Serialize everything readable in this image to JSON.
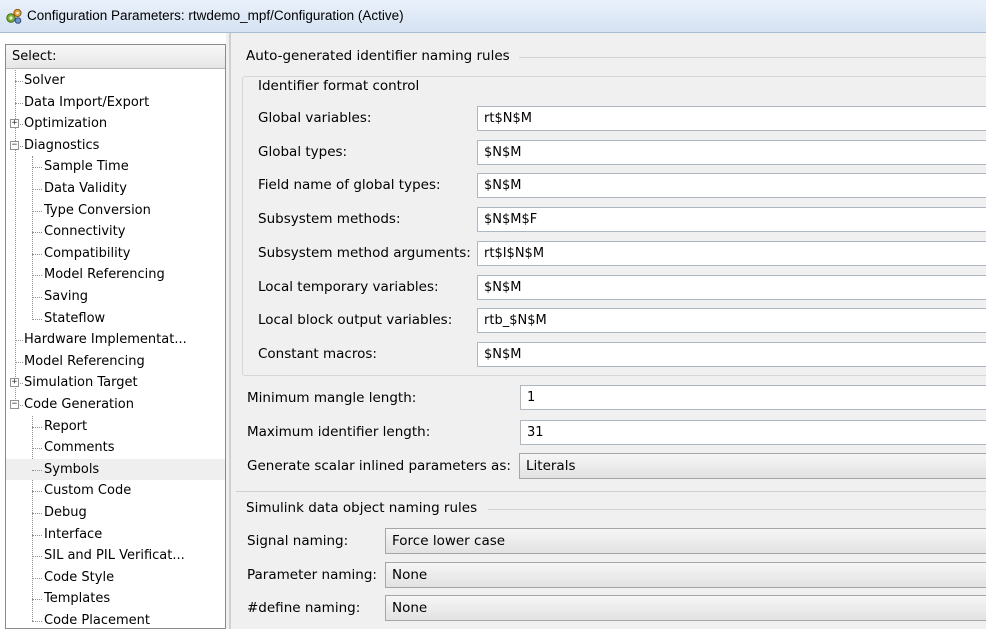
{
  "window": {
    "title": "Configuration Parameters: rtwdemo_mpf/Configuration (Active)",
    "icon": "gear-cluster-icon"
  },
  "tree": {
    "header": "Select:",
    "items": [
      {
        "label": "Solver"
      },
      {
        "label": "Data Import/Export"
      },
      {
        "label": "Optimization"
      },
      {
        "label": "Diagnostics"
      },
      {
        "label": "Sample Time"
      },
      {
        "label": "Data Validity"
      },
      {
        "label": "Type Conversion"
      },
      {
        "label": "Connectivity"
      },
      {
        "label": "Compatibility"
      },
      {
        "label": "Model Referencing"
      },
      {
        "label": "Saving"
      },
      {
        "label": "Stateflow"
      },
      {
        "label": "Hardware Implementat..."
      },
      {
        "label": "Model Referencing"
      },
      {
        "label": "Simulation Target"
      },
      {
        "label": "Code Generation"
      },
      {
        "label": "Report"
      },
      {
        "label": "Comments"
      },
      {
        "label": "Symbols"
      },
      {
        "label": "Custom Code"
      },
      {
        "label": "Debug"
      },
      {
        "label": "Interface"
      },
      {
        "label": "SIL and PIL Verificat..."
      },
      {
        "label": "Code Style"
      },
      {
        "label": "Templates"
      },
      {
        "label": "Code Placement"
      }
    ],
    "expand_glyphs": {
      "collapsed": "+",
      "expanded": "−"
    },
    "selected_item": "Symbols"
  },
  "auto_naming": {
    "title": "Auto-generated identifier naming rules",
    "format_group": {
      "title": "Identifier format control",
      "fields": [
        {
          "label": "Global variables:",
          "value": "rt$N$M"
        },
        {
          "label": "Global types:",
          "value": "$N$M"
        },
        {
          "label": "Field name of global types:",
          "value": "$N$M"
        },
        {
          "label": "Subsystem methods:",
          "value": "$N$M$F"
        },
        {
          "label": "Subsystem method arguments:",
          "value": "rt$I$N$M"
        },
        {
          "label": "Local temporary variables:",
          "value": "$N$M"
        },
        {
          "label": "Local block output variables:",
          "value": "rtb_$N$M"
        },
        {
          "label": "Constant macros:",
          "value": "$N$M"
        }
      ]
    },
    "min_mangle": {
      "label": "Minimum mangle length:",
      "value": "1"
    },
    "max_identifier": {
      "label": "Maximum identifier length:",
      "value": "31"
    },
    "scalar_inlined": {
      "label": "Generate scalar inlined parameters as:",
      "value": "Literals"
    }
  },
  "simulink_naming": {
    "title": "Simulink data object naming rules",
    "signal": {
      "label": "Signal naming:",
      "value": "Force lower case"
    },
    "parameter": {
      "label": "Parameter naming:",
      "value": "None"
    },
    "define": {
      "label": "#define naming:",
      "value": "None"
    }
  }
}
